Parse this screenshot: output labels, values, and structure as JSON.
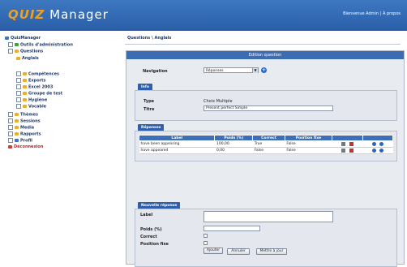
{
  "header": {
    "brand_quiz": "QUIZ",
    "brand_manager": "Manager",
    "links": "Bienvenue Admin | À propos"
  },
  "sidebar": {
    "items": [
      {
        "label": "QuizManager",
        "icon": "globe-icon"
      },
      {
        "label": "Outils d'administration",
        "icon": "tools-icon"
      },
      {
        "label": "Questions",
        "icon": "folder-icon"
      },
      {
        "label": "Anglais",
        "icon": "folder-icon"
      },
      {
        "label": "Compétences",
        "icon": "folder-icon"
      },
      {
        "label": "Exports",
        "icon": "folder-icon"
      },
      {
        "label": "Excel 2003",
        "icon": "folder-icon"
      },
      {
        "label": "Groupe de test",
        "icon": "folder-icon"
      },
      {
        "label": "Hygiène",
        "icon": "folder-icon"
      },
      {
        "label": "Vocable",
        "icon": "folder-icon"
      },
      {
        "label": "Thèmes",
        "icon": "folder-icon"
      },
      {
        "label": "Sessions",
        "icon": "folder-icon"
      },
      {
        "label": "Media",
        "icon": "folder-icon"
      },
      {
        "label": "Rapports",
        "icon": "folder-icon"
      },
      {
        "label": "Profil",
        "icon": "user-icon"
      },
      {
        "label": "Déconnexion",
        "icon": "logout-icon"
      }
    ]
  },
  "main": {
    "breadcrumb": "Questions \\ Anglais",
    "panel_title": "Edition question",
    "navigation_label": "Navigation",
    "navigation_value": "Réponses",
    "info_tab": "Info",
    "type_label": "Type",
    "type_value": "Choix Multiple",
    "title_label": "Titre",
    "title_value": "Present perfect Simple",
    "answers_tab": "Réponses",
    "table_headers": [
      "Label",
      "Poids (%)",
      "Correct",
      "Position fixe",
      "",
      ""
    ],
    "rows": [
      {
        "label": "have been appearing",
        "weight": "100,00",
        "correct": "True",
        "fixed": "False"
      },
      {
        "label": "have appeared",
        "weight": "0,00",
        "correct": "False",
        "fixed": "False"
      }
    ],
    "new_answer_tab": "Nouvelle réponse",
    "label_label": "Label",
    "weight_label": "Poids (%)",
    "correct_label": "Correct",
    "fixed_label": "Position fixe",
    "add_button": "Ajouter",
    "cancel_button": "Annuler",
    "update_button": "Mettre à jour"
  }
}
